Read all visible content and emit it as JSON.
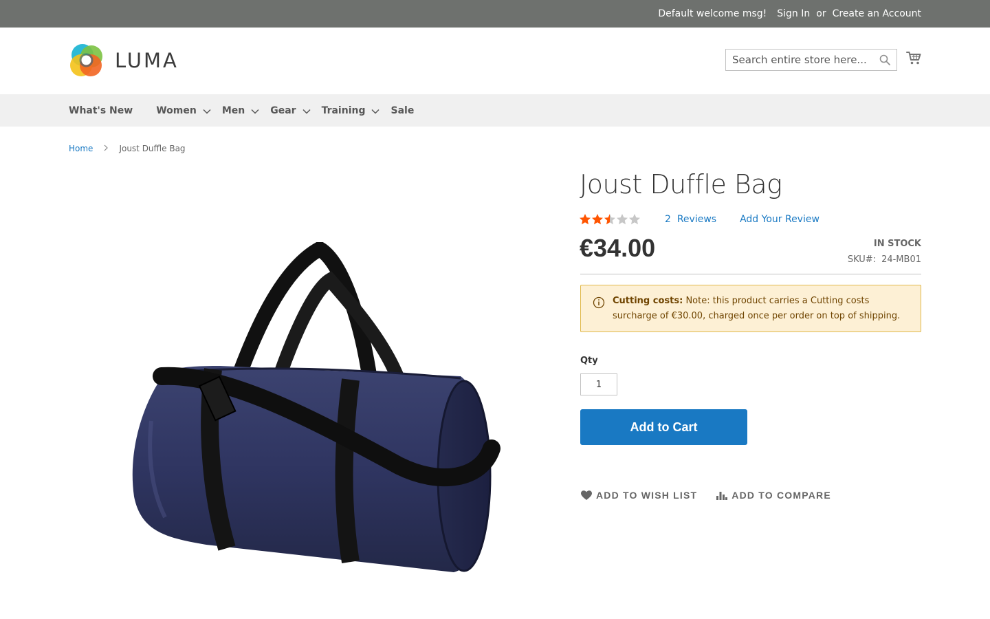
{
  "topbar": {
    "welcome": "Default welcome msg!",
    "sign_in": "Sign In",
    "or": "or",
    "create_account": "Create an Account"
  },
  "header": {
    "logo_text": "LUMA",
    "search_placeholder": "Search entire store here...",
    "search_icon": "search-icon",
    "cart_icon": "cart-icon"
  },
  "nav": {
    "items": [
      {
        "label": "What's New",
        "has_submenu": false
      },
      {
        "label": "Women",
        "has_submenu": true
      },
      {
        "label": "Men",
        "has_submenu": true
      },
      {
        "label": "Gear",
        "has_submenu": true
      },
      {
        "label": "Training",
        "has_submenu": true
      },
      {
        "label": "Sale",
        "has_submenu": false
      }
    ]
  },
  "breadcrumbs": {
    "home": "Home",
    "separator": ">",
    "current": "Joust Duffle Bag"
  },
  "product": {
    "title": "Joust Duffle Bag",
    "rating_stars": 2.5,
    "rating_max": 5,
    "reviews_count": "2",
    "reviews_label": "Reviews",
    "add_review": "Add Your Review",
    "price": "€34.00",
    "stock": "IN STOCK",
    "sku_label": "SKU#:",
    "sku": "24-MB01",
    "image_icon": "duffle-bag-image"
  },
  "notice": {
    "icon": "info-icon",
    "title": "Cutting costs:",
    "text": "Note: this product carries a Cutting costs surcharge of €30.00, charged once per order on top of shipping."
  },
  "purchase": {
    "qty_label": "Qty",
    "qty_value": "1",
    "add_to_cart": "Add to Cart"
  },
  "actions": {
    "wishlist": "Add to Wish List",
    "compare": "Add to Compare"
  },
  "colors": {
    "topbar_bg": "#6e716e",
    "nav_bg": "#f0f0f0",
    "link": "#1979c3",
    "button_bg": "#1979c3",
    "star_filled": "#ff5501",
    "star_empty": "#c7c7c7",
    "notice_bg": "#fdf0d5",
    "notice_text": "#6f4400"
  }
}
